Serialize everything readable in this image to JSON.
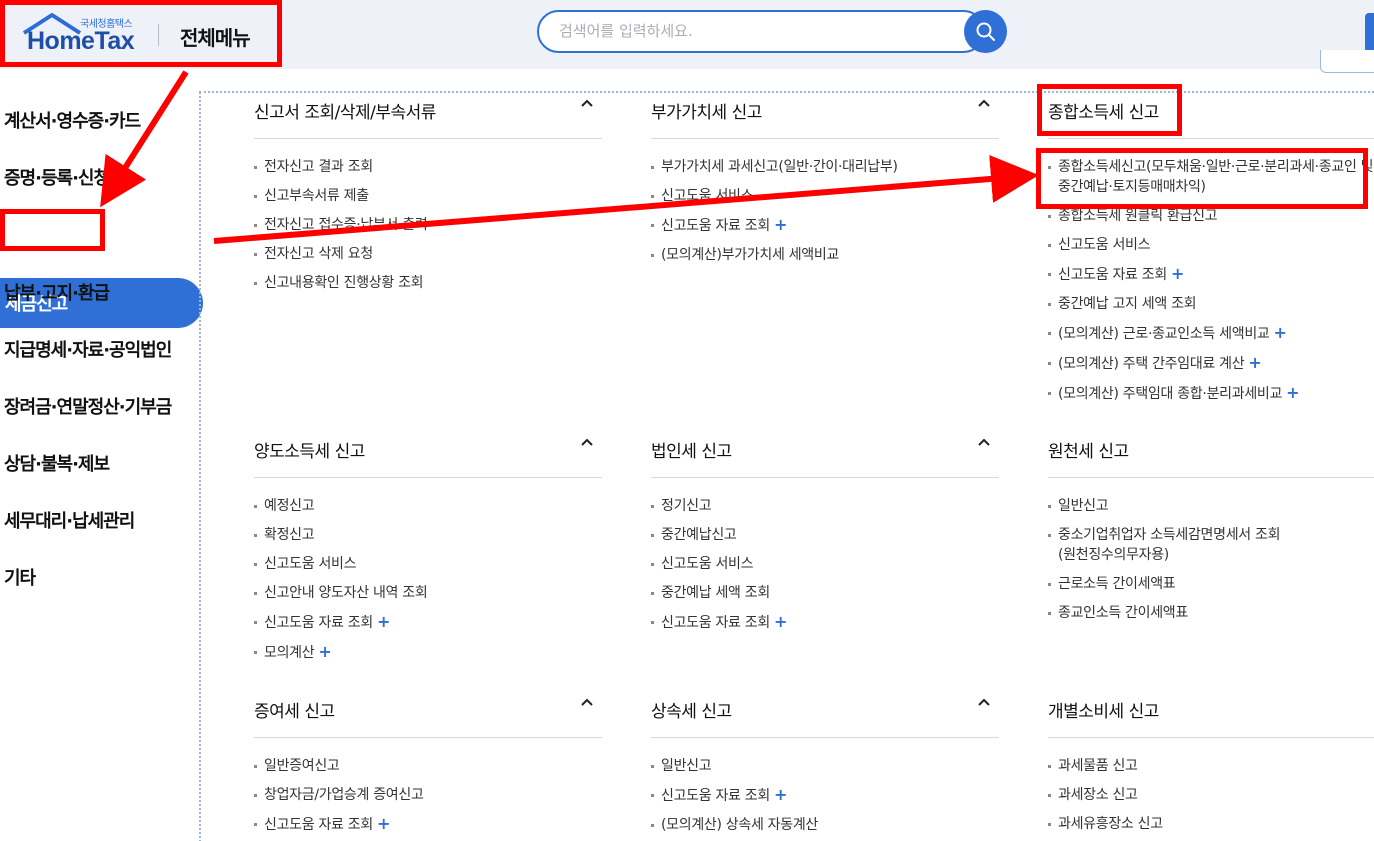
{
  "header": {
    "logo_sub": "국세청홈택스",
    "logo_main": "HomeTax",
    "menu_title": "전체메뉴",
    "search_placeholder": "검색어를 입력하세요."
  },
  "sidebar": {
    "items": [
      {
        "label": "계산서·영수증·카드"
      },
      {
        "label": "증명·등록·신청"
      },
      {
        "label": "세금신고",
        "active": true
      },
      {
        "label": "납부·고지·환급"
      },
      {
        "label": "지급명세·자료·공익법인"
      },
      {
        "label": "장려금·연말정산·기부금"
      },
      {
        "label": "상담·불복·제보"
      },
      {
        "label": "세무대리·납세관리"
      },
      {
        "label": "기타"
      }
    ]
  },
  "sections": [
    {
      "title": "신고서 조회/삭제/부속서류",
      "items": [
        "전자신고 결과 조회",
        "신고부속서류 제출",
        "전자신고 접수증·납부서 출력",
        "전자신고 삭제 요청",
        "신고내용확인 진행상황 조회"
      ]
    },
    {
      "title": "부가가치세 신고",
      "items": [
        "부가가치세 과세신고(일반·간이·대리납부)",
        "신고도움 서비스",
        "신고도움 자료 조회",
        "(모의계산)부가가치세 세액비교"
      ]
    },
    {
      "title": "종합소득세 신고",
      "items": [
        "종합소득세신고(모두채움·일반·근로·분리과세·종교인 및 중간예납·토지등매매차익)",
        "종합소득세 원클릭 환급신고",
        "신고도움 서비스",
        "신고도움 자료 조회",
        "중간예납 고지 세액 조회",
        "(모의계산) 근로·종교인소득 세액비교",
        "(모의계산) 주택 간주임대료 계산",
        "(모의계산) 주택임대 종합·분리과세비교"
      ]
    },
    {
      "title": "양도소득세 신고",
      "items": [
        "예정신고",
        "확정신고",
        "신고도움 서비스",
        "신고안내 양도자산 내역 조회",
        "신고도움 자료 조회",
        "모의계산"
      ]
    },
    {
      "title": "법인세 신고",
      "items": [
        "정기신고",
        "중간예납신고",
        "신고도움 서비스",
        "중간예납 세액 조회",
        "신고도움 자료 조회"
      ]
    },
    {
      "title": "원천세 신고",
      "items": [
        "일반신고",
        "중소기업취업자 소득세감면명세서 조회 (원천징수의무자용)",
        "근로소득 간이세액표",
        "종교인소득 간이세액표"
      ]
    },
    {
      "title": "증여세 신고",
      "items": [
        "일반증여신고",
        "창업자금/가업승계 증여신고",
        "신고도움 자료 조회"
      ]
    },
    {
      "title": "상속세 신고",
      "items": [
        "일반신고",
        "신고도움 자료 조회",
        "(모의계산) 상속세 자동계산"
      ]
    },
    {
      "title": "개별소비세 신고",
      "items": [
        "과세물품 신고",
        "과세장소 신고",
        "과세유흥장소 신고"
      ]
    }
  ],
  "colors": {
    "accent": "#2f6fd6",
    "annotation_red": "#ff0000"
  }
}
